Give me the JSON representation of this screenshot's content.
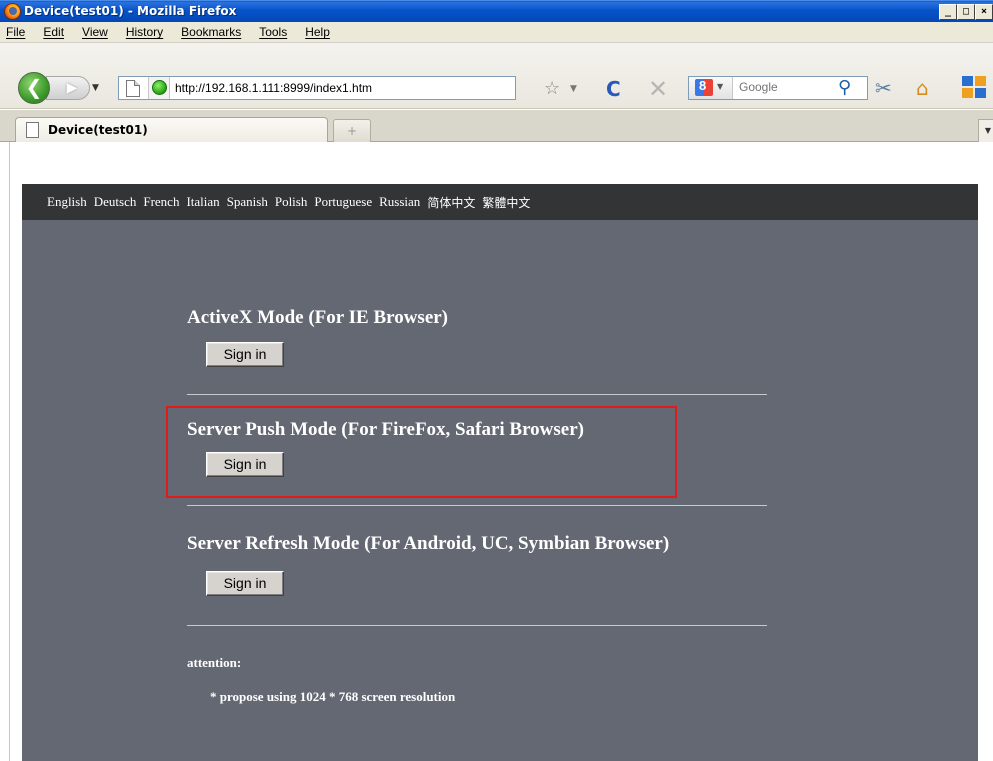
{
  "window": {
    "title": "Device(test01) - Mozilla Firefox",
    "buttons": [
      "_",
      "□",
      "×"
    ]
  },
  "menu": [
    "File",
    "Edit",
    "View",
    "History",
    "Bookmarks",
    "Tools",
    "Help"
  ],
  "navbar": {
    "url": "http://192.168.1.111:8999/index1.htm",
    "search_placeholder": "Google"
  },
  "tabs": [
    {
      "label": "Device(test01)"
    }
  ],
  "newtab_label": "+",
  "page": {
    "languages": [
      "English",
      "Deutsch",
      "French",
      "Italian",
      "Spanish",
      "Polish",
      "Portuguese",
      "Russian",
      "简体中文",
      "繁體中文"
    ],
    "modes": [
      {
        "title": "ActiveX Mode (For IE Browser)",
        "button": "Sign in"
      },
      {
        "title": "Server Push Mode (For FireFox, Safari Browser)",
        "button": "Sign in"
      },
      {
        "title": "Server Refresh Mode (For Android, UC, Symbian Browser)",
        "button": "Sign in"
      }
    ],
    "attention_label": "attention:",
    "attention_note": "* propose using 1024 * 768 screen resolution"
  },
  "colors": {
    "page_background": "#646873",
    "language_bar": "#333435",
    "highlight": "#e01b1b"
  }
}
